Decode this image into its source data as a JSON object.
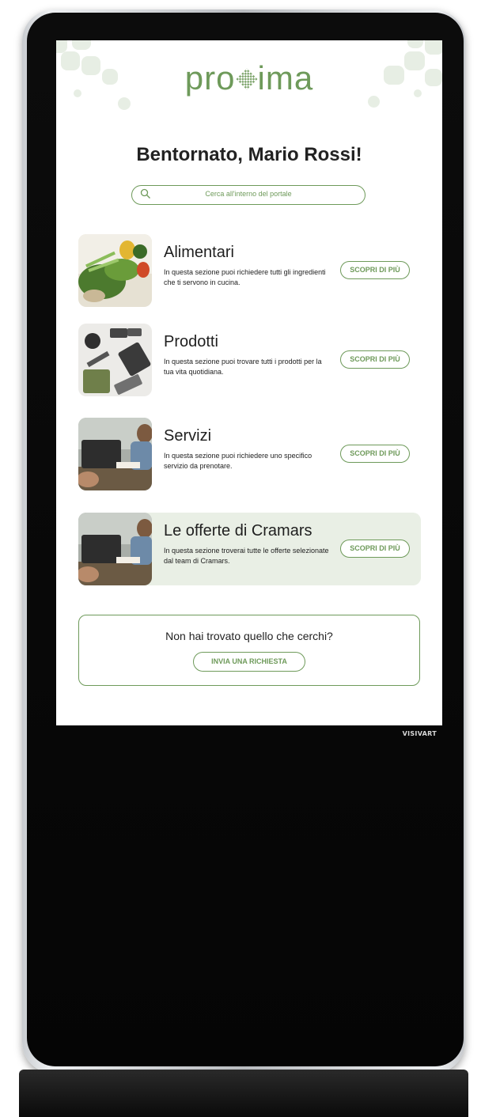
{
  "device": {
    "brand": "VISIVART"
  },
  "app": {
    "logo_text": "proxima",
    "greeting": "Bentornato, Mario Rossi!",
    "search": {
      "placeholder": "Cerca all'interno del portale",
      "icon": "search-icon"
    },
    "accent_color": "#6e9a5a",
    "highlight_bg": "#e9efe5",
    "sections": [
      {
        "title": "Alimentari",
        "description": "In questa sezione puoi richiedere tutti gli ingredienti che ti servono in cucina.",
        "button": "SCOPRI DI PIÙ",
        "image": "vegetables-photo",
        "highlighted": false
      },
      {
        "title": "Prodotti",
        "description": "In questa sezione puoi trovare tutti i prodotti per la tua vita quotidiana.",
        "button": "SCOPRI DI PIÙ",
        "image": "flatlay-products-photo",
        "highlighted": false
      },
      {
        "title": "Servizi",
        "description": "In questa sezione puoi richiedere uno specifico servizio da prenotare.",
        "button": "SCOPRI DI PIÙ",
        "image": "office-meeting-photo",
        "highlighted": false
      },
      {
        "title": "Le offerte di Cramars",
        "description": "In questa sezione troverai tutte le offerte selezionate dal team di Cramars.",
        "button": "SCOPRI DI PIÙ",
        "image": "office-meeting-photo",
        "highlighted": true
      }
    ],
    "help": {
      "question": "Non hai trovato quello che cerchi?",
      "button": "INVIA UNA RICHIESTA"
    }
  }
}
